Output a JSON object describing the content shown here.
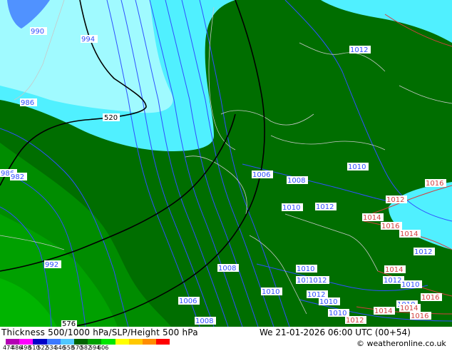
{
  "footer": {
    "title": "Thickness 500/1000 hPa/SLP/Height 500 hPa",
    "valid": "We 21-01-2026 06:00 UTC (00+54)",
    "credit": "© weatheronline.co.uk"
  },
  "scale": {
    "labels": [
      "474",
      "486",
      "498",
      "510",
      "522",
      "534",
      "546",
      "558",
      "570",
      "582",
      "594",
      "606"
    ],
    "colors": [
      "#b400b4",
      "#ff00ff",
      "#0000c8",
      "#3c78ff",
      "#50c8ff",
      "#006400",
      "#00a000",
      "#00e600",
      "#ffff00",
      "#ffc800",
      "#ff8c00",
      "#ff0000"
    ]
  },
  "map": {
    "colors": {
      "dark_green": "#006e00",
      "mid_green": "#008c00",
      "bright_green": "#00b400",
      "cyan": "#50f0ff",
      "light_cyan": "#a0faff",
      "isobar_blue": "#3050ff",
      "isobar_red": "#d24040",
      "label_bg": "#ffffff"
    },
    "labels": [
      {
        "text": "990",
        "color": "blue"
      },
      {
        "text": "994",
        "color": "blue"
      },
      {
        "text": "986",
        "color": "blue"
      },
      {
        "text": "520",
        "color": "black"
      },
      {
        "text": "986",
        "color": "blue"
      },
      {
        "text": "982",
        "color": "blue"
      },
      {
        "text": "992",
        "color": "blue"
      },
      {
        "text": "1012",
        "color": "blue"
      },
      {
        "text": "1006",
        "color": "blue"
      },
      {
        "text": "1008",
        "color": "blue"
      },
      {
        "text": "1010",
        "color": "blue"
      },
      {
        "text": "1010",
        "color": "blue"
      },
      {
        "text": "1012",
        "color": "blue"
      },
      {
        "text": "1012",
        "color": "red"
      },
      {
        "text": "1014",
        "color": "red"
      },
      {
        "text": "1016",
        "color": "red"
      },
      {
        "text": "1014",
        "color": "red"
      },
      {
        "text": "1016",
        "color": "red"
      },
      {
        "text": "1012",
        "color": "blue"
      },
      {
        "text": "1008",
        "color": "blue"
      },
      {
        "text": "1010",
        "color": "blue"
      },
      {
        "text": "1010",
        "color": "blue"
      },
      {
        "text": "1012",
        "color": "blue"
      },
      {
        "text": "1014",
        "color": "red"
      },
      {
        "text": "1012",
        "color": "blue"
      },
      {
        "text": "1010",
        "color": "blue"
      },
      {
        "text": "1010",
        "color": "blue"
      },
      {
        "text": "1012",
        "color": "blue"
      },
      {
        "text": "1016",
        "color": "red"
      },
      {
        "text": "1010",
        "color": "blue"
      },
      {
        "text": "1010",
        "color": "blue"
      },
      {
        "text": "1010",
        "color": "blue"
      },
      {
        "text": "1014",
        "color": "red"
      },
      {
        "text": "1014",
        "color": "red"
      },
      {
        "text": "1016",
        "color": "red"
      },
      {
        "text": "1012",
        "color": "red"
      },
      {
        "text": "1006",
        "color": "blue"
      },
      {
        "text": "1008",
        "color": "blue"
      },
      {
        "text": "576",
        "color": "black"
      }
    ]
  }
}
